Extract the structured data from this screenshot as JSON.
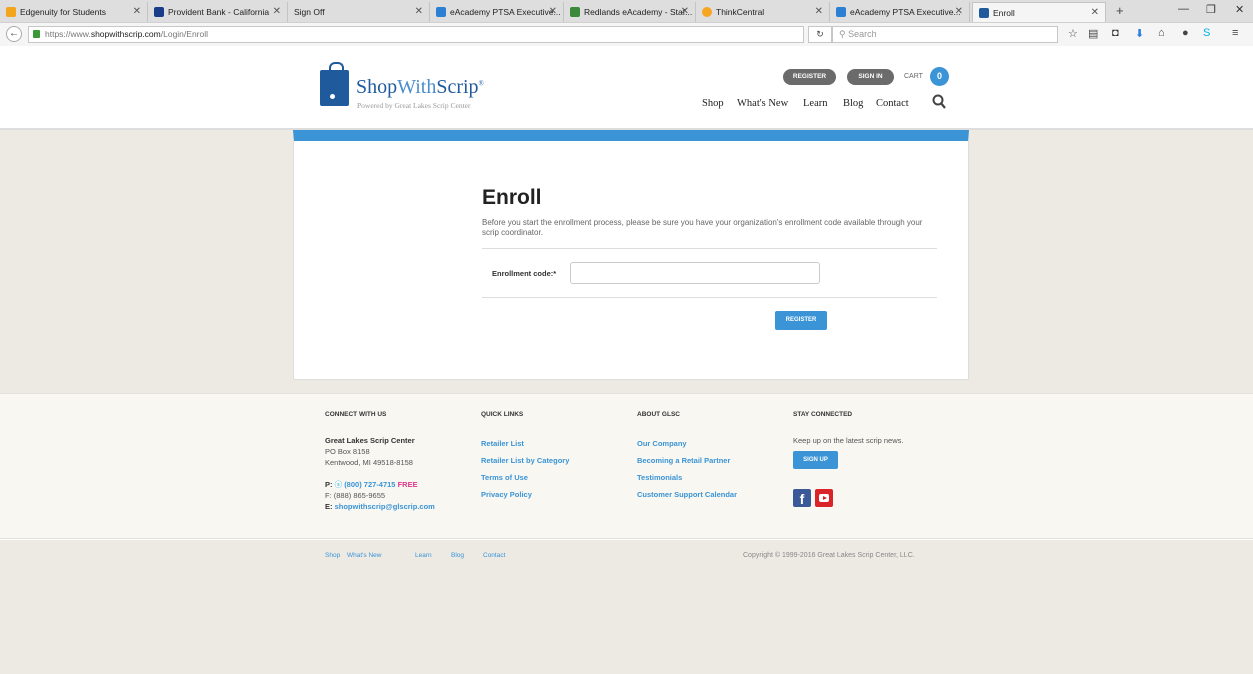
{
  "tabs": [
    {
      "title": "Edgenuity for Students",
      "color": "#f3a51c"
    },
    {
      "title": "Provident Bank - California",
      "color": "#1b3c8b"
    },
    {
      "title": "Sign Off",
      "color": "#dedede"
    },
    {
      "title": "eAcademy PTSA Executive...",
      "color": "#2d7fd3"
    },
    {
      "title": "Redlands eAcademy - Staf...",
      "color": "#3a8a3a"
    },
    {
      "title": "ThinkCentral",
      "color": "#f6a623"
    },
    {
      "title": "eAcademy PTSA Executive...",
      "color": "#2d7fd3"
    },
    {
      "title": "Enroll",
      "color": "#1e5a9c"
    }
  ],
  "browser": {
    "url_prefix": "https://www.",
    "url_domain": "shopwithscrip.com",
    "url_path": "/Login/Enroll",
    "search_placeholder": "Search"
  },
  "header": {
    "logo_shop": "Shop",
    "logo_with": "With",
    "logo_scrip": "Scrip",
    "logo_tag": "Powered by Great Lakes Scrip Center",
    "register_label": "REGISTER",
    "signin_label": "SIGN IN",
    "cart_label": "CART",
    "cart_count": "0",
    "nav": [
      "Shop",
      "What's New",
      "Learn",
      "Blog",
      "Contact"
    ]
  },
  "enroll": {
    "title": "Enroll",
    "description": "Before you start the enrollment process, please be sure you have your organization's enrollment code available through your scrip coordinator.",
    "code_label": "Enrollment code:*",
    "code_value": "",
    "register_button": "REGISTER"
  },
  "footer": {
    "connect_heading": "CONNECT WITH US",
    "org_name": "Great Lakes Scrip Center",
    "address_line1": "PO Box 8158",
    "address_line2": "Kentwood, MI 49518-8158",
    "phone_prefix": "P:",
    "phone": "(800) 727-4715",
    "phone_free": "FREE",
    "fax": "F: (888) 865-9655",
    "email_prefix": "E:",
    "email": "shopwithscrip@glscrip.com",
    "quick_heading": "QUICK LINKS",
    "quick_links": [
      "Retailer List",
      "Retailer List by Category",
      "Terms of Use",
      "Privacy Policy"
    ],
    "about_heading": "ABOUT GLSC",
    "about_links": [
      "Our Company",
      "Becoming a Retail Partner",
      "Testimonials",
      "Customer Support Calendar"
    ],
    "stay_heading": "STAY CONNECTED",
    "stay_text": "Keep up on the latest scrip news.",
    "signup_label": "SIGN UP"
  },
  "bottom": {
    "links": [
      "Shop",
      "What's New",
      "Learn",
      "Blog",
      "Contact"
    ],
    "copyright": "Copyright © 1999-2016 Great Lakes Scrip Center, LLC."
  }
}
